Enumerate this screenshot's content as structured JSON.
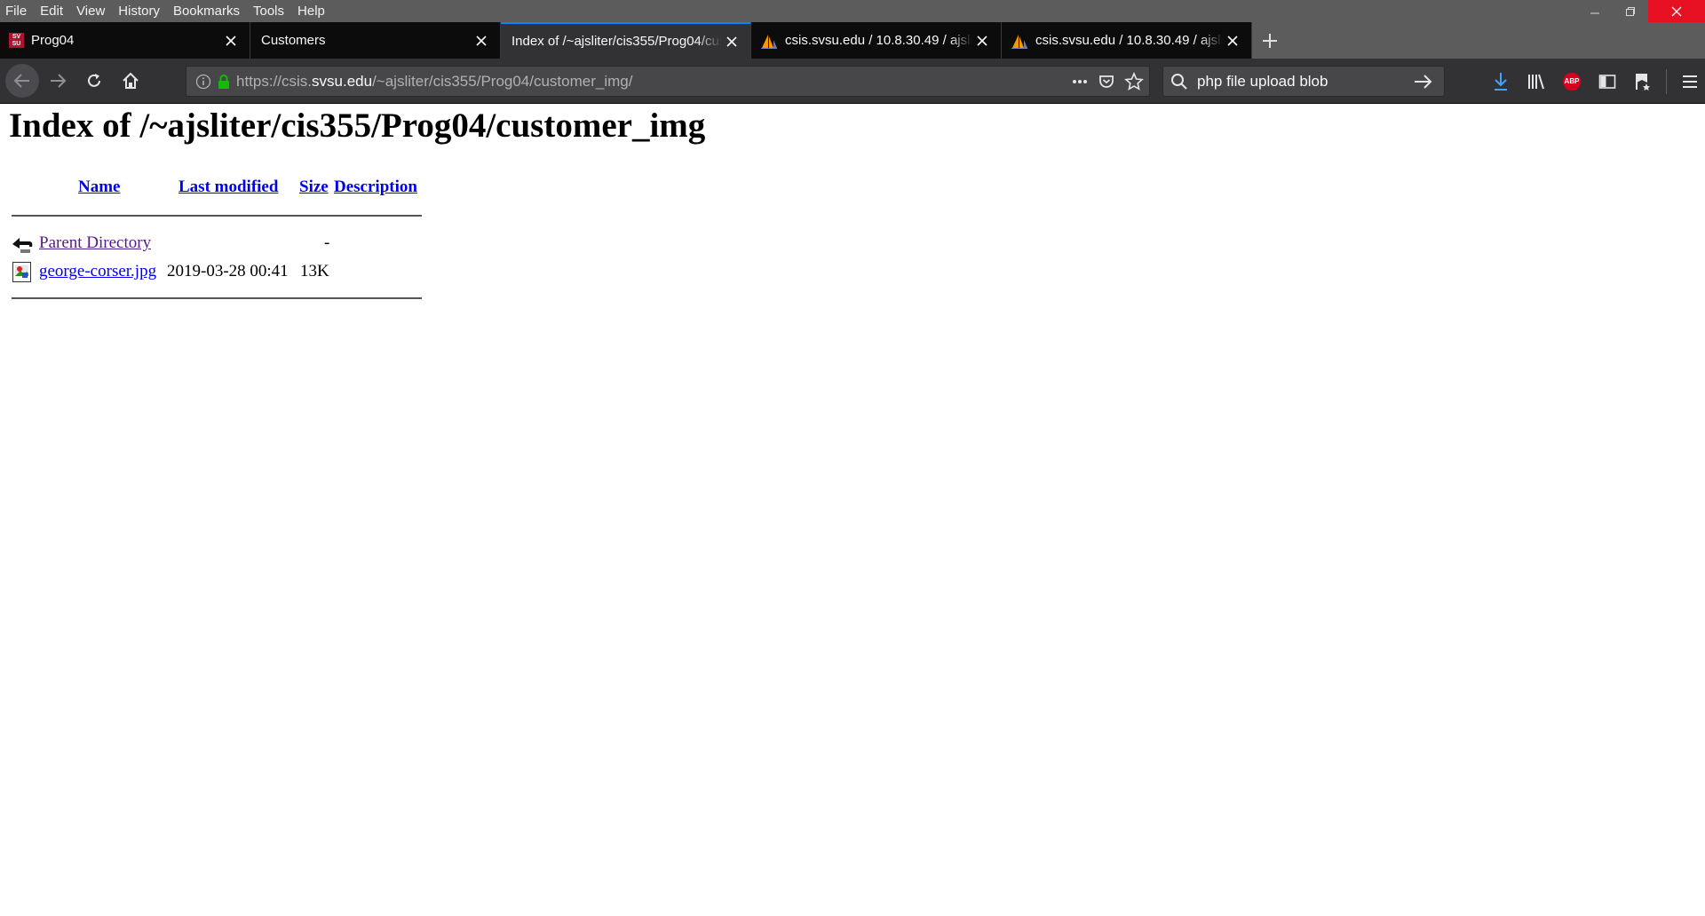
{
  "menu": {
    "items": [
      "File",
      "Edit",
      "View",
      "History",
      "Bookmarks",
      "Tools",
      "Help"
    ]
  },
  "tabs": [
    {
      "title": "Prog04",
      "favicon": "svsu-logo-icon",
      "favicon_text_top": "SV",
      "favicon_text_bottom": "SU",
      "active": false
    },
    {
      "title": "Customers",
      "favicon": "",
      "active": false
    },
    {
      "title": "Index of /~ajsliter/cis355/Prog04/customer_img",
      "favicon": "",
      "active": true
    },
    {
      "title": "csis.svsu.edu / 10.8.30.49 / ajsliter",
      "favicon": "phpmyadmin-sail-icon",
      "active": false
    },
    {
      "title": "csis.svsu.edu / 10.8.30.49 / ajsliter",
      "favicon": "phpmyadmin-sail-icon",
      "active": false
    }
  ],
  "urlbar": {
    "scheme": "https://csis.",
    "host": "svsu.edu",
    "path": "/~ajsliter/cis355/Prog04/customer_img/"
  },
  "searchbar": {
    "value": "php file upload blob"
  },
  "page": {
    "title": "Index of /~ajsliter/cis355/Prog04/customer_img",
    "columns": {
      "name": "Name",
      "last_modified": "Last modified",
      "size": "Size",
      "description": "Description"
    },
    "entries": [
      {
        "name": "Parent Directory",
        "modified": "",
        "size": "-",
        "icon": "back-arrow-icon",
        "visited": true
      },
      {
        "name": "george-corser.jpg",
        "modified": "2019-03-28 00:41",
        "size": "13K",
        "icon": "image-file-icon",
        "visited": false
      }
    ]
  },
  "colors": {
    "chrome_bg": "#5c5c5c",
    "tab_bg": "#0c0c0d",
    "active_tab_accent": "#0a84ff",
    "toolbar_bg": "#323234",
    "close_button": "#e81123",
    "link": "#0000ee",
    "visited_link": "#551a8b",
    "secure_lock": "#12bc00"
  }
}
